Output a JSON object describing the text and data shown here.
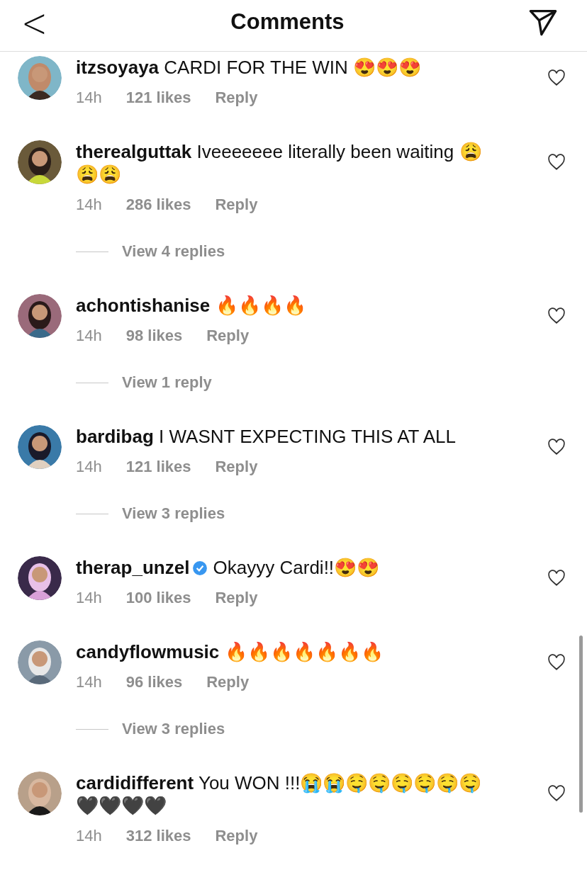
{
  "header": {
    "back": "<",
    "title": "Comments"
  },
  "comments": [
    {
      "username": "itzsoyaya",
      "verified": false,
      "text": "CARDI FOR THE WIN 😍😍😍",
      "time": "14h",
      "likes": "121 likes",
      "reply": "Reply"
    },
    {
      "username": "therealguttak",
      "verified": false,
      "text": "Iveeeeeee literally been waiting 😩😩😩",
      "time": "14h",
      "likes": "286 likes",
      "reply": "Reply",
      "view_replies": "View 4 replies"
    },
    {
      "username": "achontishanise",
      "verified": false,
      "text": "🔥🔥🔥🔥",
      "time": "14h",
      "likes": "98 likes",
      "reply": "Reply",
      "view_replies": "View 1 reply"
    },
    {
      "username": "bardibag",
      "verified": false,
      "text": "I WASNT EXPECTING THIS AT ALL",
      "time": "14h",
      "likes": "121 likes",
      "reply": "Reply",
      "view_replies": "View 3 replies"
    },
    {
      "username": "therap_unzel",
      "verified": true,
      "text": "Okayyy Cardi!!😍😍",
      "time": "14h",
      "likes": "100 likes",
      "reply": "Reply"
    },
    {
      "username": "candyflowmusic",
      "verified": false,
      "text": "🔥🔥🔥🔥🔥🔥🔥",
      "time": "14h",
      "likes": "96 likes",
      "reply": "Reply",
      "view_replies": "View 3 replies"
    },
    {
      "username": "cardidifferent",
      "verified": false,
      "text": "You WON !!!😭😭🤤🤤🤤🤤🤤🤤🖤🖤🖤🖤",
      "time": "14h",
      "likes": "312 likes",
      "reply": "Reply"
    }
  ]
}
